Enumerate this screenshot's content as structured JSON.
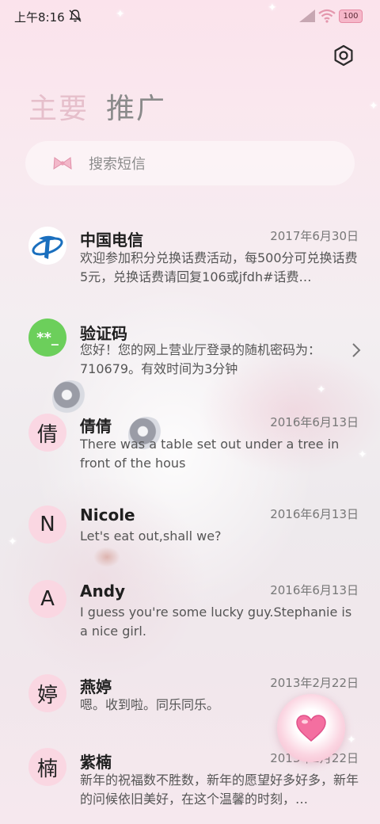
{
  "status_bar": {
    "time": "上午8:16",
    "battery": "100"
  },
  "tabs": [
    {
      "label": "主要"
    },
    {
      "label": "推广"
    }
  ],
  "search": {
    "placeholder": "搜索短信"
  },
  "messages": [
    {
      "sender": "中国电信",
      "date": "2017年6月30日",
      "preview": "欢迎参加积分兑换话费活动，每500分可兑换话费5元，兑换话费请回复106或jfdh#话费…",
      "avatar": "telecom-logo"
    },
    {
      "sender": "验证码",
      "date": "",
      "preview": "您好！您的网上营业厅登录的随机密码为：710679。有效时间为3分钟",
      "avatar_text": "**_"
    },
    {
      "sender": "倩倩",
      "date": "2016年6月13日",
      "preview": "There was a table set out under a tree in front of the hous",
      "avatar_text": "倩"
    },
    {
      "sender": "Nicole",
      "date": "2016年6月13日",
      "preview": "Let's eat out,shall we?",
      "avatar_text": "N"
    },
    {
      "sender": "Andy",
      "date": "2016年6月13日",
      "preview": "I guess you're some lucky guy.Stephanie is a nice girl.",
      "avatar_text": "A"
    },
    {
      "sender": "燕婷",
      "date": "2013年2月22日",
      "preview": "嗯。收到啦。同乐同乐。",
      "avatar_text": "婷"
    },
    {
      "sender": "紫楠",
      "date": "2013年2月22日",
      "preview": "新年的祝福数不胜数，新年的愿望好多好多，新年的问候依旧美好，在这个温馨的时刻，…",
      "avatar_text": "楠"
    }
  ],
  "colors": {
    "tab_active": "#e6bfcb",
    "tab_inactive": "#8a8a8a",
    "code_avatar": "#6ccf5b",
    "letter_avatar": "#fad6e2",
    "telecom_blue": "#1a6fbe"
  },
  "icons": [
    "mute-icon",
    "signal-icon",
    "wifi-icon",
    "battery-icon",
    "settings-icon",
    "bow-icon",
    "chevron-right-icon",
    "heart-icon"
  ]
}
